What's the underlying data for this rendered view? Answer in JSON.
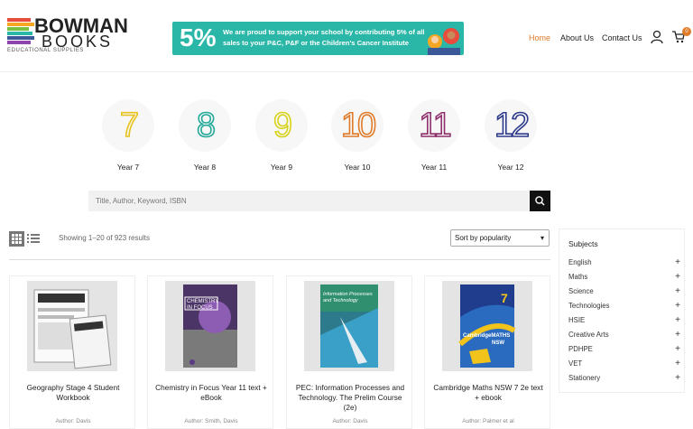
{
  "logo": {
    "line1": "BOWMAN",
    "line2": "BOOKS",
    "line3": "EDUCATIONAL SUPPLIES",
    "bar_colors": [
      "#e94b3c",
      "#f5a623",
      "#7bc043",
      "#2bb7a8",
      "#3b5998",
      "#8e44ad"
    ]
  },
  "banner": {
    "percent": "5%",
    "text": "We are proud to support your school by contributing 5% of all sales to your P&C, P&F or the Children's Cancer Institute"
  },
  "nav": {
    "home": "Home",
    "about": "About Us",
    "contact": "Contact Us",
    "cart_count": "0"
  },
  "years": [
    {
      "num": "7",
      "label": "Year 7",
      "color": "#e8c21c"
    },
    {
      "num": "8",
      "label": "Year 8",
      "color": "#23a99a"
    },
    {
      "num": "9",
      "label": "Year 9",
      "color": "#d9d21a"
    },
    {
      "num": "10",
      "label": "Year 10",
      "color": "#e07b2a"
    },
    {
      "num": "11",
      "label": "Year 11",
      "color": "#8e2f6c"
    },
    {
      "num": "12",
      "label": "Year 12",
      "color": "#2e3a8c"
    }
  ],
  "search": {
    "placeholder": "Title, Author, Keyword, ISBN"
  },
  "results": {
    "showing": "Showing 1–20 of 923 results",
    "sort": "Sort by popularity"
  },
  "products": [
    {
      "title": "Geography Stage 4 Student Workbook",
      "author": "Author: Davis",
      "cover": "#dcdcdc",
      "cover_text": "GEOGRAPHY"
    },
    {
      "title": "Chemistry in Focus Year 11 text + eBook",
      "author": "Author: Smith, Davis",
      "cover": "#6b4a8c",
      "cover_text": "CHEMISTRY IN FOCUS"
    },
    {
      "title": "PEC: Information Processes and Technology. The Prelim Course (2e)",
      "author": "Author: Davis",
      "cover": "#2f8f6f",
      "cover_text": "Information Processes and Technology"
    },
    {
      "title": "Cambridge Maths NSW 7 2e text + ebook",
      "author": "Author: Palmer et al",
      "cover": "#f2c31a",
      "cover_text": "CambridgeMATHS NSW"
    }
  ],
  "sidebar": {
    "heading": "Subjects",
    "items": [
      "English",
      "Maths",
      "Science",
      "Technologies",
      "HSIE",
      "Creative Arts",
      "PDHPE",
      "VET",
      "Stationery"
    ]
  }
}
